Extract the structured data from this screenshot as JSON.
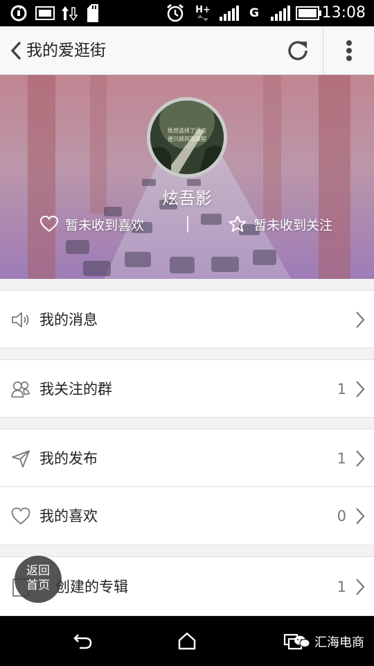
{
  "status_bar": {
    "network": "H+",
    "network2": "G",
    "time": "13:08"
  },
  "app_bar": {
    "title": "我的爱逛街"
  },
  "profile": {
    "avatar_text_line1": "既然选择了远方",
    "avatar_text_line2": "便只顾风雨兼程",
    "username": "炫吾影",
    "likes_label": "暂未收到喜欢",
    "follows_label": "暂未收到关注"
  },
  "menu": [
    {
      "label": "我的消息",
      "count": "",
      "icon": "speaker-icon"
    },
    {
      "label": "我关注的群",
      "count": "1",
      "icon": "group-icon"
    },
    {
      "label": "我的发布",
      "count": "1",
      "icon": "send-icon"
    },
    {
      "label": "我的喜欢",
      "count": "0",
      "icon": "heart-icon"
    },
    {
      "label": "创建的专辑",
      "count": "1",
      "icon": "album-icon"
    }
  ],
  "home_button": {
    "line1": "返回",
    "line2": "首页"
  },
  "watermark": "汇海电商",
  "colors": {
    "accent_text": "#222222",
    "list_background": "#ffffff",
    "page_background": "#f2f2f4",
    "banner_tint": "#a97fb0"
  }
}
